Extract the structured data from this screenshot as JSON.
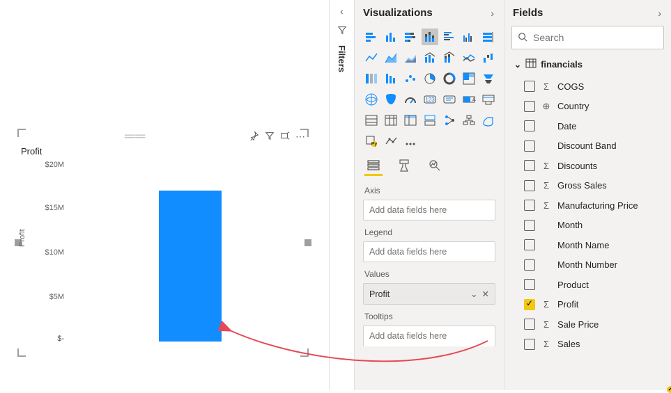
{
  "panes": {
    "filters_label": "Filters",
    "visualizations_title": "Visualizations",
    "fields_title": "Fields"
  },
  "search": {
    "placeholder": "Search"
  },
  "table": {
    "name": "financials"
  },
  "fields": [
    {
      "name": "COGS",
      "type": "sigma",
      "checked": false
    },
    {
      "name": "Country",
      "type": "globe",
      "checked": false
    },
    {
      "name": "Date",
      "type": "",
      "checked": false
    },
    {
      "name": "Discount Band",
      "type": "",
      "checked": false
    },
    {
      "name": "Discounts",
      "type": "sigma",
      "checked": false
    },
    {
      "name": "Gross Sales",
      "type": "sigma",
      "checked": false
    },
    {
      "name": "Manufacturing Price",
      "type": "sigma",
      "checked": false
    },
    {
      "name": "Month",
      "type": "",
      "checked": false
    },
    {
      "name": "Month Name",
      "type": "",
      "checked": false
    },
    {
      "name": "Month Number",
      "type": "",
      "checked": false
    },
    {
      "name": "Product",
      "type": "",
      "checked": false
    },
    {
      "name": "Profit",
      "type": "sigma",
      "checked": true
    },
    {
      "name": "Sale Price",
      "type": "sigma",
      "checked": false
    },
    {
      "name": "Sales",
      "type": "sigma",
      "checked": false
    }
  ],
  "wells": {
    "axis_label": "Axis",
    "axis_placeholder": "Add data fields here",
    "legend_label": "Legend",
    "legend_placeholder": "Add data fields here",
    "values_label": "Values",
    "values_item": "Profit",
    "tooltips_label": "Tooltips",
    "tooltips_placeholder": "Add data fields here"
  },
  "visual": {
    "title": "Profit",
    "y_axis_label": "Profit"
  },
  "chart_data": {
    "type": "bar",
    "categories": [
      ""
    ],
    "values": [
      17000000
    ],
    "title": "Profit",
    "xlabel": "",
    "ylabel": "Profit",
    "ylim": [
      0,
      20000000
    ],
    "yticks": [
      "$20M",
      "$15M",
      "$10M",
      "$5M",
      "$-"
    ]
  }
}
